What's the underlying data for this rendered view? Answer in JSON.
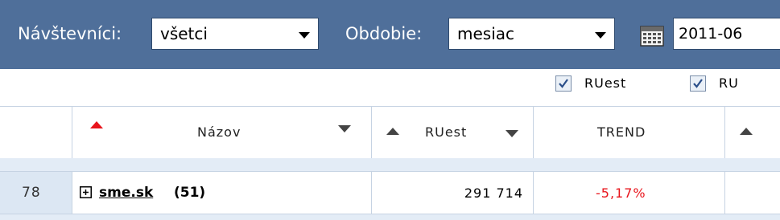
{
  "toolbar": {
    "visitors_label": "Návštevníci:",
    "visitors_value": "všetci",
    "period_label": "Obdobie:",
    "period_value": "mesiac",
    "date_value": "2011-06",
    "calendar_icon": "calendar-icon"
  },
  "columns_toggle": [
    {
      "label": "RUest",
      "checked": true
    },
    {
      "label": "RU",
      "checked": true
    }
  ],
  "table": {
    "headers": {
      "name": "Názov",
      "ruest": "RUest",
      "trend": "TREND"
    },
    "sort_active_color": "#e8141b",
    "rows": [
      {
        "rank": "78",
        "expand_icon": "plus-box-icon",
        "site": "sme.sk",
        "count": "(51)",
        "ruest": "291 714",
        "trend": "-5,17%",
        "trend_color": "#e8141b"
      }
    ]
  },
  "colors": {
    "toolbar_bg": "#4f6f9a",
    "grid_line": "#c6d3e3",
    "rank_cell_bg": "#dce7f3"
  }
}
